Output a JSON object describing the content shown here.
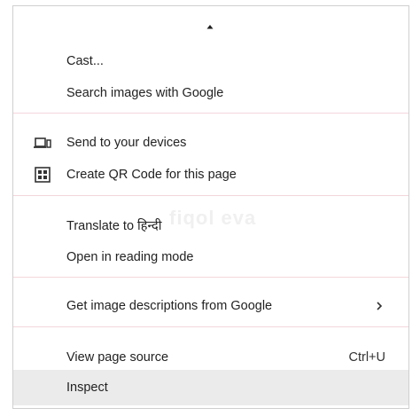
{
  "menu": {
    "items": [
      {
        "label": "Cast..."
      },
      {
        "label": "Search images with Google"
      },
      {
        "label": "Send to your devices",
        "icon": "devices-icon"
      },
      {
        "label": "Create QR Code for this page",
        "icon": "qr-code-icon"
      },
      {
        "label": "Translate to हिन्दी"
      },
      {
        "label": "Open in reading mode"
      },
      {
        "label": "Get image descriptions from Google",
        "submenu": true
      },
      {
        "label": "View page source",
        "shortcut": "Ctrl+U"
      },
      {
        "label": "Inspect",
        "highlighted": true
      }
    ]
  },
  "watermark": "fiqol eva",
  "colors": {
    "divider": "#f3d6dc",
    "highlight": "#ebebeb",
    "text": "#222222"
  }
}
